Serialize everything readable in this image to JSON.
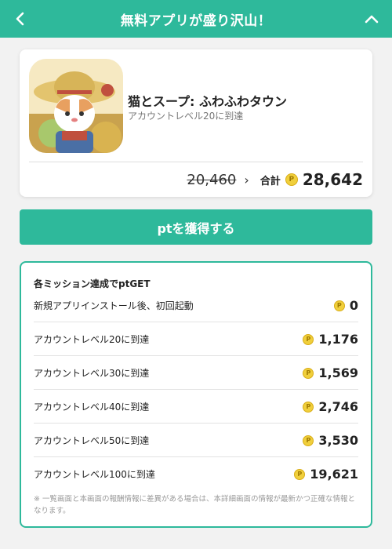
{
  "header": {
    "title": "無料アプリが盛り沢山！"
  },
  "app": {
    "name": "猫とスープ: ふわふわタウン",
    "subtitle": "アカウントレベル20に到達",
    "old_points": "20,460",
    "arrow": "›",
    "total_label": "合計",
    "total_points": "28,642"
  },
  "coin_symbol": "P",
  "get_button": {
    "label": "ptを獲得する"
  },
  "missions": {
    "title": "各ミッション達成でptGET",
    "items": [
      {
        "label": "新規アプリインストール後、初回起動",
        "points": "0"
      },
      {
        "label": "アカウントレベル20に到達",
        "points": "1,176"
      },
      {
        "label": "アカウントレベル30に到達",
        "points": "1,569"
      },
      {
        "label": "アカウントレベル40に到達",
        "points": "2,746"
      },
      {
        "label": "アカウントレベル50に到達",
        "points": "3,530"
      },
      {
        "label": "アカウントレベル100に到達",
        "points": "19,621"
      }
    ],
    "note": "※ 一覧画面と本画面の報酬情報に差異がある場合は、本詳細画面の情報が最新かつ正確な情報となります。"
  },
  "colors": {
    "accent": "#2eb99b",
    "coin": "#f0cf3c"
  }
}
